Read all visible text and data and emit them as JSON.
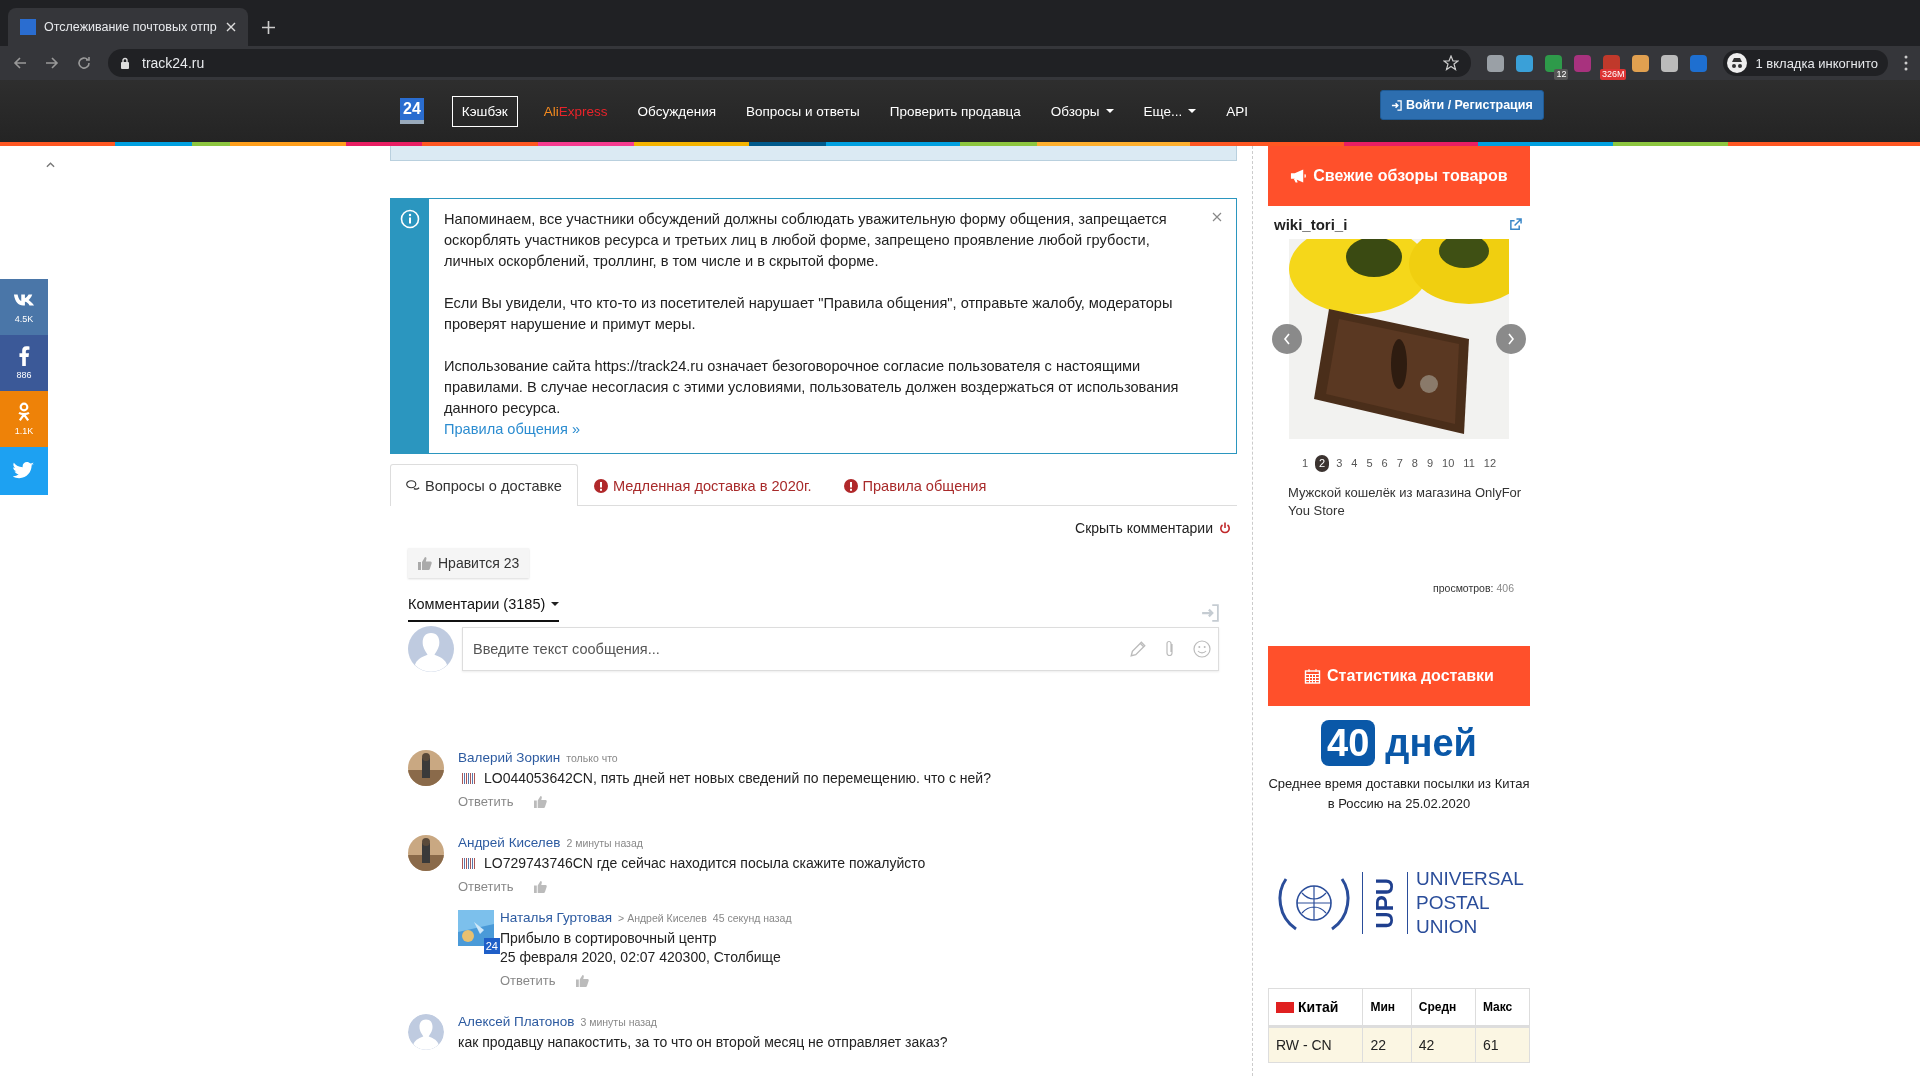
{
  "browser": {
    "tab_title": "Отслеживание почтовых отпр",
    "url": "track24.ru",
    "extension_badges": [
      "12",
      "326M"
    ],
    "incognito": "1 вкладка инкогнито"
  },
  "nav": {
    "logo": "24",
    "items": [
      {
        "label": "Кэшбэк",
        "kind": "boxed",
        "dropdown": false
      },
      {
        "label": "Ali",
        "label_2": "Express",
        "kind": "brand",
        "dropdown": false
      },
      {
        "label": "Обсуждения",
        "kind": "plain",
        "dropdown": false
      },
      {
        "label": "Вопросы и ответы",
        "kind": "plain",
        "dropdown": false
      },
      {
        "label": "Проверить продавца",
        "kind": "plain",
        "dropdown": false
      },
      {
        "label": "Обзоры",
        "kind": "plain",
        "dropdown": true
      },
      {
        "label": "Еще...",
        "kind": "plain",
        "dropdown": true
      },
      {
        "label": "API",
        "kind": "plain",
        "dropdown": false
      }
    ],
    "login": "Войти / Регистрация"
  },
  "social": [
    {
      "kind": "vk",
      "count": "4.5K"
    },
    {
      "kind": "facebook",
      "count": "886"
    },
    {
      "kind": "ok",
      "count": "1.1K"
    },
    {
      "kind": "twitter"
    }
  ],
  "notice": {
    "paragraphs": [
      "Напоминаем, все участники обсуждений должны соблюдать уважительную форму общения, запрещается оскорблять участников ресурса и третьих лиц в любой форме, запрещено проявление любой грубости, личных оскорблений, троллинг, в том числе и в скрытой форме.",
      "Если Вы увидели, что кто-то из посетителей нарушает \"Правила общения\", отправьте жалобу, модераторы проверят нарушение и примут меры.",
      "Использование сайта https://track24.ru означает безоговорочное согласие пользователя с настоящими правилами. В случае несогласия с этими условиями, пользователь должен воздержаться от использования данного ресурса."
    ],
    "link": "Правила общения »"
  },
  "tabs": [
    {
      "label": "Вопросы о доставке",
      "kind": "chat",
      "selected": true
    },
    {
      "label": "Медленная доставка в 2020г.",
      "kind": "alert",
      "selected": false
    },
    {
      "label": "Правила общения",
      "kind": "alert",
      "selected": false
    }
  ],
  "hide_comments": "Скрыть комментарии",
  "like": "Нравится 23",
  "comments_header": "Комментарии (3185)",
  "composer": {
    "placeholder": "Введите текст сообщения..."
  },
  "comments": [
    {
      "author": "Валерий Зоркин",
      "time": "только что",
      "barcode": true,
      "lines": [
        "LO044053642CN, пять дней нет новых сведений по перемещению. что с ней?"
      ],
      "reply": "Ответить"
    },
    {
      "author": "Андрей Киселев",
      "time": "2 минуты назад",
      "barcode": true,
      "lines": [
        "LO729743746CN где сейчас находится посыла скажите пожалуйсто"
      ],
      "reply": "Ответить",
      "children": [
        {
          "author": "Наталья Гуртовая",
          "reply_to": "> Андрей Киселев",
          "time": "45 секунд назад",
          "avatar_badge": "24",
          "barcode": false,
          "lines": [
            "Прибыло в сортировочный центр",
            "25 февраля 2020, 02:07 420300, Столбище"
          ],
          "reply": "Ответить"
        }
      ]
    },
    {
      "author": "Алексей Платонов",
      "time": "3 минуты назад",
      "kind": "default",
      "barcode": false,
      "lines": [
        "как продавцу напакостить, за то что он второй месяц не отправляет заказ?"
      ]
    }
  ],
  "reviews": {
    "header": "Свежие обзоры товаров",
    "user": "wiki_tori_i",
    "pages": [
      {
        "label": "1",
        "selected": false
      },
      {
        "label": "2",
        "selected": true
      },
      {
        "label": "3",
        "selected": false
      },
      {
        "label": "4",
        "selected": false
      },
      {
        "label": "5",
        "selected": false
      },
      {
        "label": "6",
        "selected": false
      },
      {
        "label": "7",
        "selected": false
      },
      {
        "label": "8",
        "selected": false
      },
      {
        "label": "9",
        "selected": false
      },
      {
        "label": "10",
        "selected": false
      },
      {
        "label": "11",
        "selected": false
      },
      {
        "label": "12",
        "selected": false
      }
    ],
    "caption": "Мужской кошелёк из магазина OnlyFor You Store",
    "views_label": "просмотров:",
    "views": "406"
  },
  "stats": {
    "header": "Статистика доставки",
    "days_number": "40",
    "days_word": "дней",
    "description": "Среднее время доставки посылки из Китая в Россию на 25.02.2020",
    "logo": {
      "acronym": "UPU",
      "lines": [
        "UNIVERSAL",
        "POSTAL",
        "UNION"
      ]
    },
    "table": {
      "columns": [
        "Китай",
        "Мин",
        "Средн",
        "Макс"
      ],
      "rows": [
        [
          "RW - CN",
          "22",
          "42",
          "61"
        ]
      ]
    }
  }
}
